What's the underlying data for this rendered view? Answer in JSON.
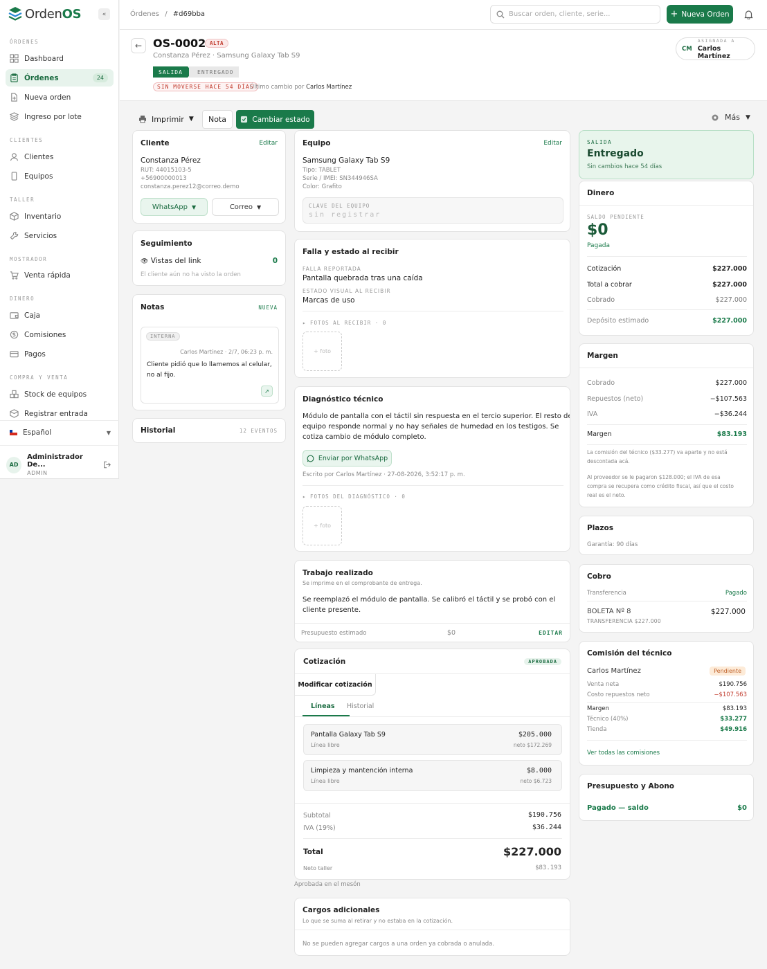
{
  "brand": {
    "name_part1": "Orden",
    "name_part2": "OS"
  },
  "sidebar": {
    "sections": [
      {
        "title": "ÓRDENES",
        "items": [
          {
            "label": "Dashboard"
          },
          {
            "label": "Órdenes",
            "badge": "24",
            "active": true
          },
          {
            "label": "Nueva orden"
          },
          {
            "label": "Ingreso por lote"
          }
        ]
      },
      {
        "title": "CLIENTES",
        "items": [
          {
            "label": "Clientes"
          },
          {
            "label": "Equipos"
          }
        ]
      },
      {
        "title": "TALLER",
        "items": [
          {
            "label": "Inventario"
          },
          {
            "label": "Servicios"
          }
        ]
      },
      {
        "title": "MOSTRADOR",
        "items": [
          {
            "label": "Venta rápida"
          }
        ]
      },
      {
        "title": "DINERO",
        "items": [
          {
            "label": "Caja"
          },
          {
            "label": "Comisiones"
          },
          {
            "label": "Pagos"
          }
        ]
      },
      {
        "title": "COMPRA Y VENTA",
        "items": [
          {
            "label": "Stock de equipos"
          },
          {
            "label": "Registrar entrada"
          }
        ]
      }
    ],
    "language": "Español",
    "user": {
      "initials": "AD",
      "name": "Administrador De...",
      "role": "ADMIN"
    }
  },
  "topbar": {
    "breadcrumb_root": "Órdenes",
    "breadcrumb_sep": "/",
    "breadcrumb_current": "#d69bba",
    "search_placeholder": "Buscar orden, cliente, serie...",
    "new_order": "Nueva Orden"
  },
  "order": {
    "id": "OS-0002",
    "priority": "ALTA",
    "subtitle": "Constanza Pérez · Samsung Galaxy Tab S9",
    "stage_current": "SALIDA",
    "stage_next": "ENTREGADO",
    "stale": "SIN MOVERSE HACE 54 DÍAS",
    "last_change_prefix": "Último cambio por",
    "last_change_by": "Carlos Martínez",
    "assigned_label": "ASIGNADA A",
    "assigned_initials": "CM",
    "assigned_name": "Carlos Martínez"
  },
  "actions": {
    "print": "Imprimir",
    "note": "Nota",
    "change_state": "Cambiar estado",
    "more": "Más"
  },
  "client": {
    "title": "Cliente",
    "edit": "Editar",
    "name": "Constanza Pérez",
    "rut": "RUT: 44015103-5",
    "phone": "+56900000013",
    "email": "constanza.perez12@correo.demo",
    "whatsapp": "WhatsApp",
    "email_btn": "Correo"
  },
  "tracking": {
    "title": "Seguimiento",
    "views_label": "Vistas del link",
    "views": "0",
    "note": "El cliente aún no ha visto la orden"
  },
  "notes": {
    "title": "Notas",
    "new": "NUEVA",
    "tag": "INTERNA",
    "meta": "Carlos Martínez · 2/7, 06:23 p. m.",
    "text_line1": "Cliente pidió que lo llamemos al celular,",
    "text_line2": "no al fijo."
  },
  "history": {
    "title": "Historial",
    "count": "12 EVENTOS"
  },
  "device": {
    "title": "Equipo",
    "edit": "Editar",
    "name": "Samsung Galaxy Tab S9",
    "type": "Tipo: TABLET",
    "serial": "Serie / IMEI: SN344946SA",
    "color": "Color: Grafito",
    "key_label": "CLAVE DEL EQUIPO",
    "key_value": "sin registrar"
  },
  "fault": {
    "title": "Falla y estado al recibir",
    "reported_label": "FALLA REPORTADA",
    "reported": "Pantalla quebrada tras una caída",
    "visual_label": "ESTADO VISUAL AL RECIBIR",
    "visual": "Marcas de uso",
    "photos_label": "FOTOS AL RECIBIR · 0",
    "add_photo": "+ foto"
  },
  "diagnosis": {
    "title": "Diagnóstico técnico",
    "line1": "Módulo de pantalla con el táctil sin respuesta en el tercio superior. El resto del",
    "line2": "equipo responde normal y no hay señales de humedad en los testigos. Se",
    "line3": "cotiza cambio de módulo completo.",
    "send_wa": "Enviar por WhatsApp",
    "meta": "Escrito por Carlos Martínez · 27-08-2026, 3:52:17 p. m.",
    "photos_label": "FOTOS DEL DIAGNÓSTICO · 0",
    "add_photo": "+ foto"
  },
  "work": {
    "title": "Trabajo realizado",
    "subtitle": "Se imprime en el comprobante de entrega.",
    "line1": "Se reemplazó el módulo de pantalla. Se calibró el táctil y se probó con el",
    "line2": "cliente presente.",
    "budget_label": "Presupuesto estimado",
    "budget_value": "$0",
    "edit": "EDITAR"
  },
  "quote": {
    "title": "Cotización",
    "status": "APROBADA",
    "modify": "Modificar cotización",
    "tab_lines": "Líneas",
    "tab_history": "Historial",
    "lines": [
      {
        "name": "Pantalla Galaxy Tab S9",
        "type": "Línea libre",
        "price": "$205.000",
        "net": "neto $172.269"
      },
      {
        "name": "Limpieza y mantención interna",
        "type": "Línea libre",
        "price": "$8.000",
        "net": "neto $6.723"
      }
    ],
    "subtotal_label": "Subtotal",
    "subtotal": "$190.756",
    "iva_label": "IVA (19%)",
    "iva": "$36.244",
    "total_label": "Total",
    "total": "$227.000",
    "net_label": "Neto taller",
    "net": "$83.193",
    "approved_note": "Aprobada en el mesón"
  },
  "extras": {
    "title": "Cargos adicionales",
    "subtitle": "Lo que se suma al retirar y no estaba en la cotización.",
    "note": "No se pueden agregar cargos a una orden ya cobrada o anulada."
  },
  "status_card": {
    "label": "SALIDA",
    "state": "Entregado",
    "since": "Sin cambios hace 54 días"
  },
  "money": {
    "title": "Dinero",
    "balance_label": "SALDO PENDIENTE",
    "balance": "$0",
    "paid": "Pagada",
    "rows": [
      {
        "label": "Cotización",
        "value": "$227.000"
      },
      {
        "label": "Total a cobrar",
        "value": "$227.000"
      },
      {
        "label": "Cobrado",
        "value": "$227.000"
      }
    ],
    "deposit_label": "Depósito estimado",
    "deposit": "$227.000"
  },
  "margin": {
    "title": "Margen",
    "collected_label": "Cobrado",
    "collected": "$227.000",
    "parts_label": "Repuestos (neto)",
    "parts": "−$107.563",
    "iva_label": "IVA",
    "iva": "−$36.244",
    "margin_label": "Margen",
    "margin": "$83.193",
    "note1_line1": "La comisión del técnico ($33.277) va aparte y no está",
    "note1_line2": "descontada acá.",
    "note2_line1": "Al proveedor se le pagaron $128.000; el IVA de esa",
    "note2_line2": "compra se recupera como crédito fiscal, así que el costo",
    "note2_line3": "real es el neto."
  },
  "terms": {
    "title": "Plazos",
    "warranty": "Garantía: 90 días"
  },
  "payment": {
    "title": "Cobro",
    "method": "Transferencia",
    "status": "Pagado",
    "doc": "BOLETA Nº 8",
    "doc_sub": "TRANSFERENCIA $227.000",
    "amount": "$227.000"
  },
  "commission": {
    "title": "Comisión del técnico",
    "tech": "Carlos Martínez",
    "status": "Pendiente",
    "rows": [
      {
        "label": "Venta neta",
        "value": "$190.756"
      },
      {
        "label": "Costo repuestos neto",
        "value": "−$107.563"
      },
      {
        "label": "Margen",
        "value": "$83.193"
      },
      {
        "label": "Técnico (40%)",
        "value": "$33.277"
      },
      {
        "label": "Tienda",
        "value": "$49.916"
      }
    ],
    "link": "Ver todas las comisiones"
  },
  "budget_card": {
    "title": "Presupuesto y Abono",
    "label": "Pagado — saldo",
    "value": "$0"
  }
}
